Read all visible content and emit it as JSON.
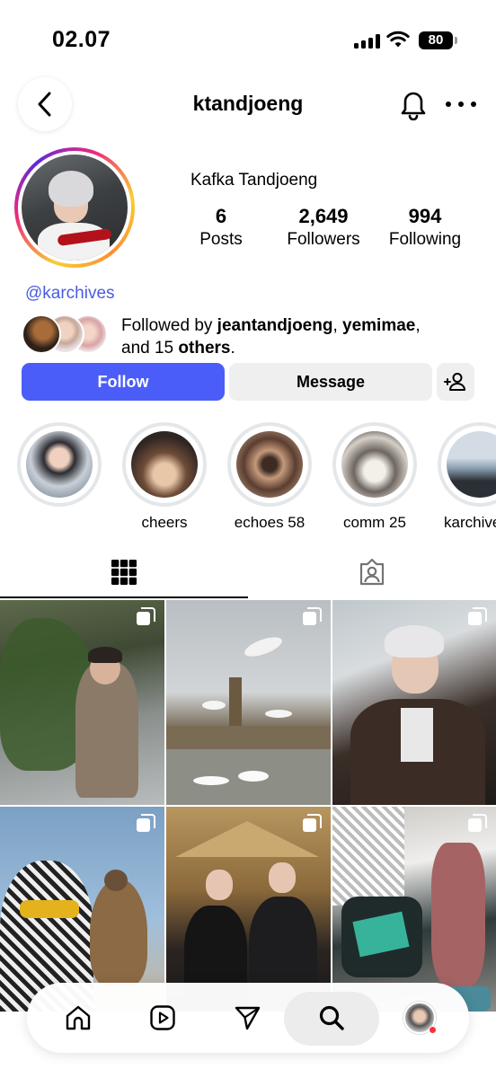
{
  "status_bar": {
    "time": "02.07",
    "battery": "80"
  },
  "header": {
    "username": "ktandjoeng"
  },
  "profile": {
    "display_name": "Kafka Tandjoeng",
    "stats": [
      {
        "value": "6",
        "label": "Posts"
      },
      {
        "value": "2,649",
        "label": "Followers"
      },
      {
        "value": "994",
        "label": "Following"
      }
    ],
    "link_handle": "@karchives",
    "followed_by": {
      "prefix": "Followed by ",
      "user1": "jeantandjoeng",
      "sep": ", ",
      "user2": "yemimae",
      "comma": ",",
      "and": "and 15 ",
      "others": "others",
      "period": "."
    }
  },
  "actions": {
    "follow_label": "Follow",
    "message_label": "Message"
  },
  "highlights": [
    {
      "label": ""
    },
    {
      "label": "cheers"
    },
    {
      "label": "echoes 58"
    },
    {
      "label": "comm 25"
    },
    {
      "label": "karchives"
    }
  ],
  "tabs": [
    {
      "icon": "grid-icon",
      "active": true
    },
    {
      "icon": "tagged-icon",
      "active": false
    }
  ],
  "posts": [
    {
      "multiple": true
    },
    {
      "multiple": true
    },
    {
      "multiple": true
    },
    {
      "multiple": true
    },
    {
      "multiple": true
    },
    {
      "multiple": true
    }
  ],
  "bottom_nav": [
    {
      "icon": "home-icon"
    },
    {
      "icon": "reels-icon"
    },
    {
      "icon": "send-icon"
    },
    {
      "icon": "search-icon",
      "active": true
    },
    {
      "icon": "profile-avatar"
    }
  ],
  "colors": {
    "follow_button": "#4a5df9",
    "link": "#4a5ce0",
    "secondary_button": "#efefef",
    "notification_dot": "#ff2d3a"
  }
}
